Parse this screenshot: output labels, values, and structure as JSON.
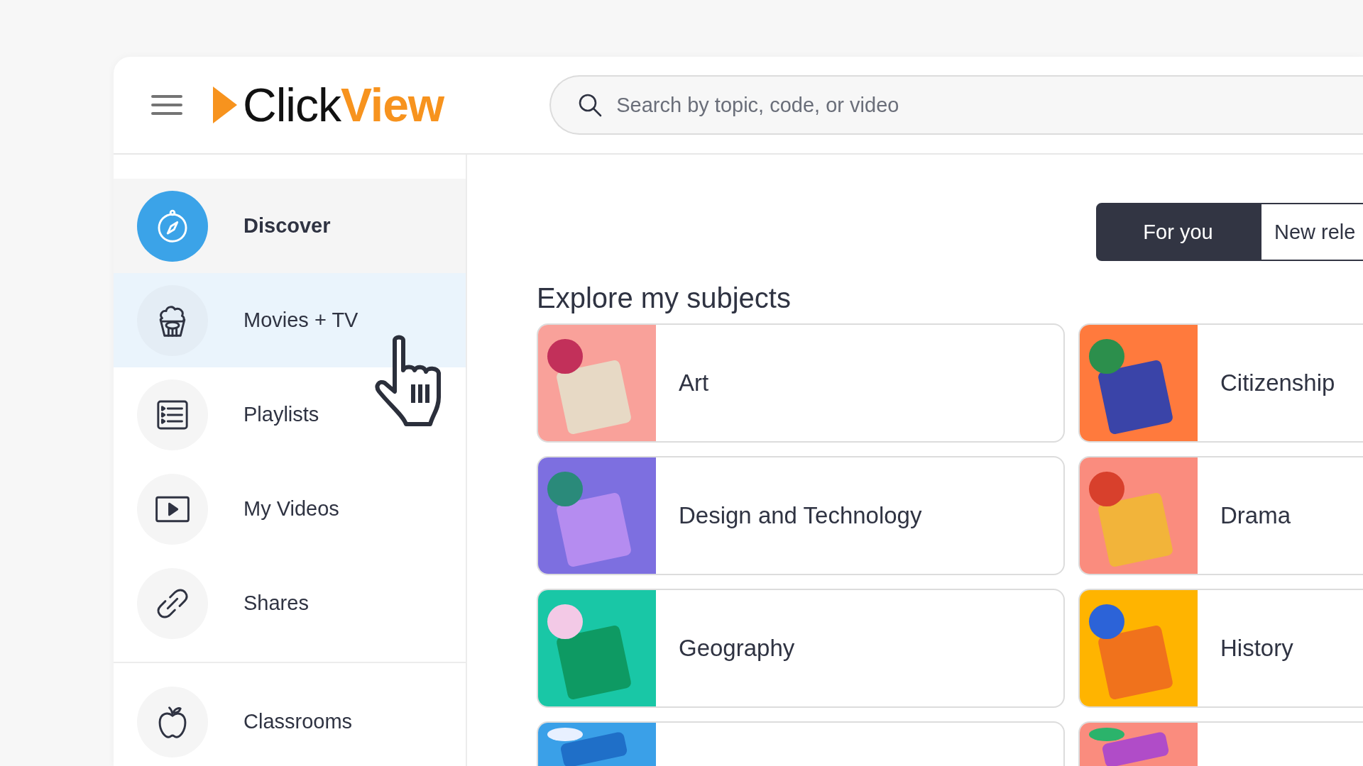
{
  "header": {
    "logo": {
      "parts": [
        "Click",
        "View"
      ]
    },
    "search": {
      "placeholder": "Search by topic, code, or video"
    }
  },
  "sidebar": {
    "groups": [
      {
        "items": [
          {
            "label": "Discover",
            "selected": true,
            "hovered": false
          },
          {
            "label": "Movies + TV",
            "selected": false,
            "hovered": true
          },
          {
            "label": "Playlists",
            "selected": false,
            "hovered": false
          },
          {
            "label": "My Videos",
            "selected": false,
            "hovered": false
          },
          {
            "label": "Shares",
            "selected": false,
            "hovered": false
          }
        ]
      },
      {
        "items": [
          {
            "label": "Classrooms",
            "selected": false,
            "hovered": false
          }
        ]
      }
    ]
  },
  "tabs": [
    {
      "label": "For you",
      "selected": true
    },
    {
      "label": "New rele",
      "selected": false
    }
  ],
  "subjects": {
    "title": "Explore my subjects",
    "cards": [
      {
        "kind": "subject",
        "label": "Art"
      },
      {
        "kind": "subject",
        "label": "Citizenship"
      },
      {
        "kind": "subject",
        "label": "Design and Technology"
      },
      {
        "kind": "subject",
        "label": "Drama"
      },
      {
        "kind": "subject",
        "label": "Geography"
      },
      {
        "kind": "subject",
        "label": "History"
      },
      {
        "kind": "partial"
      },
      {
        "kind": "partial"
      }
    ]
  }
}
